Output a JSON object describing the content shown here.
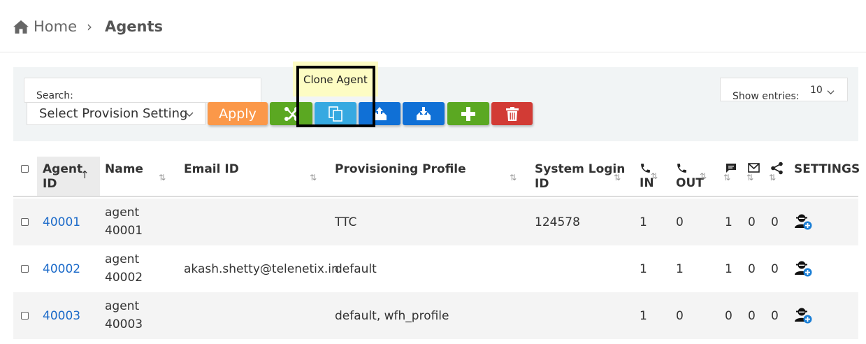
{
  "breadcrumb": {
    "home": "Home",
    "separator": "›",
    "current": "Agents"
  },
  "toolbar": {
    "search_label": "Search:",
    "search_value": "",
    "provision_select": "Select Provision Setting",
    "apply_label": "Apply",
    "tooltip": "Clone Agent",
    "show_entries_label": "Show entries:",
    "show_entries_value": "10",
    "buttons": [
      "joomla-icon",
      "clone-icon",
      "upload-icon",
      "download-icon",
      "plus-icon",
      "trash-icon"
    ]
  },
  "colors": {
    "apply": "#fb9849",
    "green": "#5ba822",
    "light_blue": "#36a9e1",
    "blue": "#1070d6",
    "red": "#d23b35",
    "link": "#1b6ac9",
    "tooltip_bg": "#fdfcc3"
  },
  "table": {
    "headers": {
      "agent_id_1": "Agent",
      "agent_id_2": "ID",
      "agent_id_sort": "↑",
      "name": "Name",
      "email": "Email ID",
      "profile": "Provisioning Profile",
      "login_1": "System Login",
      "login_2": "ID",
      "in": "IN",
      "out": "OUT",
      "settings": "SETTINGS",
      "sort": "⇅"
    },
    "rows": [
      {
        "id": "40001",
        "name_1": "agent",
        "name_2": "40001",
        "email": "",
        "profile": "TTC",
        "login": "124578",
        "in": "1",
        "out": "0",
        "chat": "1",
        "mail": "0",
        "share": "0"
      },
      {
        "id": "40002",
        "name_1": "agent",
        "name_2": "40002",
        "email": "akash.shetty@telenetix.in",
        "profile": "default",
        "login": "",
        "in": "1",
        "out": "1",
        "chat": "1",
        "mail": "0",
        "share": "0"
      },
      {
        "id": "40003",
        "name_1": "agent",
        "name_2": "40003",
        "email": "",
        "profile": "default, wfh_profile",
        "login": "",
        "in": "1",
        "out": "0",
        "chat": "0",
        "mail": "0",
        "share": "0"
      }
    ]
  }
}
